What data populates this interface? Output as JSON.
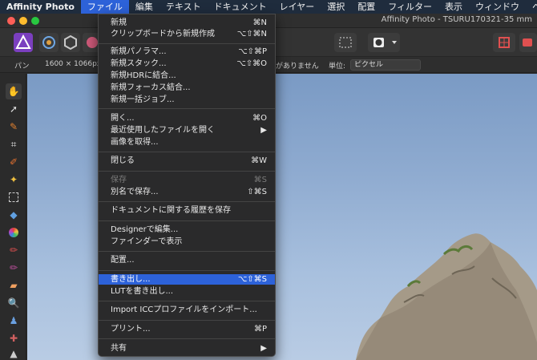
{
  "menubar": {
    "apple": "",
    "app_name": "Affinity Photo",
    "items": [
      "ファイル",
      "編集",
      "テキスト",
      "ドキュメント",
      "レイヤー",
      "選択",
      "配置",
      "フィルター",
      "表示",
      "ウィンドウ",
      "ヘルプ"
    ]
  },
  "window": {
    "title": "Affinity Photo - TSURU170321-35 mm"
  },
  "contextbar": {
    "tool_name": "パン",
    "doc_size": "1600 × 1066px,",
    "no_selection": "がありません",
    "unit_label": "単位:",
    "unit_value": "ピクセル"
  },
  "file_menu": {
    "items": [
      {
        "label": "新規",
        "shortcut": "⌘N"
      },
      {
        "label": "クリップボードから新規作成",
        "shortcut": "⌥⇧⌘N"
      },
      {
        "label": "新規パノラマ...",
        "shortcut": "⌥⇧⌘P"
      },
      {
        "label": "新規スタック...",
        "shortcut": "⌥⇧⌘O"
      },
      {
        "label": "新規HDRに結合...",
        "shortcut": ""
      },
      {
        "label": "新規フォーカス結合...",
        "shortcut": ""
      },
      {
        "label": "新規一括ジョブ...",
        "shortcut": ""
      },
      {
        "label": "開く...",
        "shortcut": "⌘O"
      },
      {
        "label": "最近使用したファイルを開く",
        "shortcut": "▶"
      },
      {
        "label": "画像を取得...",
        "shortcut": ""
      },
      {
        "label": "閉じる",
        "shortcut": "⌘W"
      },
      {
        "label": "保存",
        "shortcut": "⌘S"
      },
      {
        "label": "別名で保存...",
        "shortcut": "⇧⌘S"
      },
      {
        "label": "ドキュメントに関する履歴を保存",
        "shortcut": ""
      },
      {
        "label": "Designerで編集...",
        "shortcut": ""
      },
      {
        "label": "ファインダーで表示",
        "shortcut": ""
      },
      {
        "label": "配置...",
        "shortcut": ""
      },
      {
        "label": "書き出し...",
        "shortcut": "⌥⇧⌘S"
      },
      {
        "label": "LUTを書き出し...",
        "shortcut": ""
      },
      {
        "label": "Import ICCプロファイルをインポート...",
        "shortcut": ""
      },
      {
        "label": "プリント...",
        "shortcut": "⌘P"
      },
      {
        "label": "共有",
        "shortcut": "▶"
      }
    ]
  },
  "tools": [
    "hand-icon",
    "move-icon",
    "color-picker-icon",
    "crop-icon",
    "brush-icon",
    "magic-wand-icon",
    "marquee-icon",
    "fill-icon",
    "gradient-icon",
    "paint-brush-icon",
    "selection-brush-icon",
    "eraser-icon",
    "zoom-icon",
    "stamp-icon",
    "healing-icon",
    "sharpen-icon"
  ],
  "colors": {
    "menubar_bg": "#1f2c3d",
    "highlight": "#2d62d9",
    "menu_bg": "#2a2a2b",
    "close": "#ff5f57",
    "minimize": "#febc2e",
    "maximize": "#28c840"
  }
}
